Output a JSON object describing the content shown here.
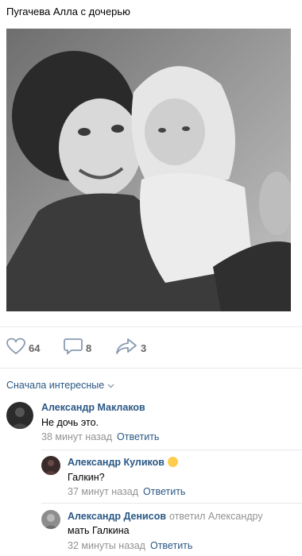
{
  "post": {
    "text": "Пугачева Алла с дочерью"
  },
  "actions": {
    "likes": "64",
    "comments": "8",
    "shares": "3"
  },
  "sort": {
    "label": "Сначала интересные"
  },
  "comments": [
    {
      "author": "Александр Маклаков",
      "text": "Не дочь это.",
      "time": "38 минут назад",
      "reply_label": "Ответить"
    },
    {
      "author": "Александр Куликов",
      "text": "Галкин?",
      "time": "37 минут назад",
      "reply_label": "Ответить"
    },
    {
      "author": "Александр Денисов",
      "reply_note": "ответил Александру",
      "text": "мать Галкина",
      "time": "32 минуты назад",
      "reply_label": "Ответить"
    }
  ],
  "colors": {
    "link": "#2a5885",
    "meta": "#939393",
    "divider": "#e7e8ec"
  }
}
